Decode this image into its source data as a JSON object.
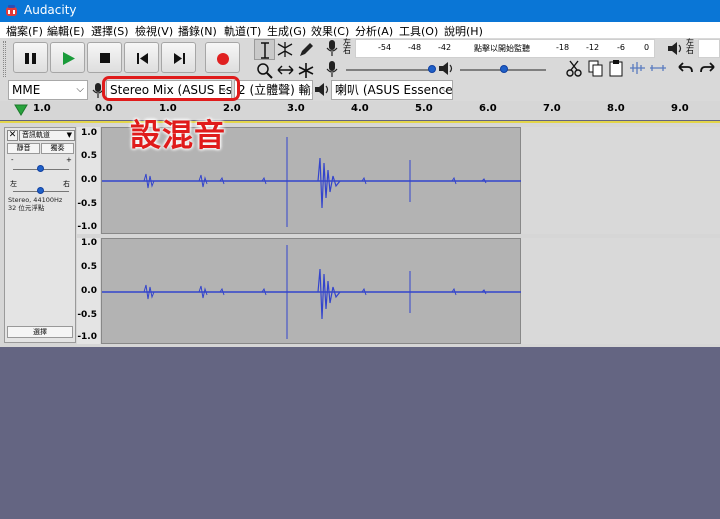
{
  "window": {
    "title": "Audacity"
  },
  "menu": [
    "檔案(F)",
    "編輯(E)",
    "選擇(S)",
    "檢視(V)",
    "播錄(N)",
    "軌道(T)",
    "生成(G)",
    "效果(C)",
    "分析(A)",
    "工具(O)",
    "說明(H)"
  ],
  "transport": {
    "buttons": [
      "pause",
      "play",
      "stop",
      "skip-to-start",
      "skip-to-end",
      "record"
    ]
  },
  "meters": {
    "record_lr": "左\n右",
    "play_lr": "左\n右",
    "ticks": [
      "-54",
      "-48",
      "-42",
      "-18",
      "-12",
      "-6",
      "0"
    ],
    "click_to_monitor": "點擊以開始監聽"
  },
  "devices": {
    "host": "MME",
    "recording_device": "Stereo Mix (ASUS Esse",
    "channels": "2 (立體聲) 輸.",
    "playback_device": "喇叭 (ASUS Essence S"
  },
  "ruler": {
    "ticks": [
      "1.0",
      "0.0",
      "1.0",
      "2.0",
      "3.0",
      "4.0",
      "5.0",
      "6.0",
      "7.0",
      "8.0",
      "9.0"
    ]
  },
  "track": {
    "name": "音訊軌道",
    "mute": "靜音",
    "solo": "獨奏",
    "gain_minus": "-",
    "gain_plus": "+",
    "pan_left": "左",
    "pan_right": "右",
    "info_line1": "Stereo, 44100Hz",
    "info_line2": "32 位元浮點",
    "select": "選擇",
    "scale_top": [
      "1.0",
      "0.5",
      "0.0",
      "-0.5",
      "-1.0"
    ],
    "scale_bottom": [
      "1.0",
      "0.5",
      "0.0",
      "-0.5",
      "-1.0"
    ]
  },
  "annotation": {
    "label": "設混音"
  },
  "colors": {
    "titlebar": "#0a76d6",
    "waveform": "#3344cc",
    "annotation": "#e01b1b",
    "background": "#646582"
  }
}
